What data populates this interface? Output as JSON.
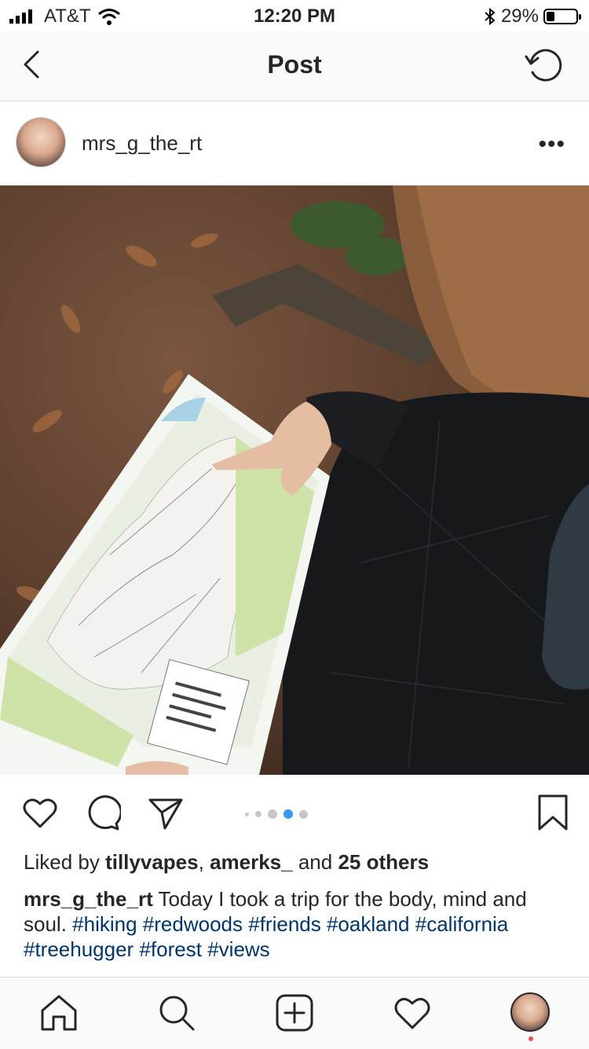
{
  "status": {
    "carrier": "AT&T",
    "time": "12:20 PM",
    "battery": "29%",
    "battery_level": 0.29
  },
  "nav": {
    "title": "Post"
  },
  "post": {
    "username": "mrs_g_the_rt",
    "carousel": {
      "count": 5,
      "active_index": 3
    },
    "likes": {
      "prefix": "Liked by",
      "user1": "tillyvapes",
      "sep": ",",
      "user2": "amerks_",
      "and": "and",
      "others": "25 others"
    },
    "caption": {
      "user": "mrs_g_the_rt",
      "text": "Today I took a trip for the body, mind and soul.",
      "tags": [
        "#hiking",
        "#redwoods",
        "#friends",
        "#oakland",
        "#california",
        "#treehugger",
        "#forest",
        "#views"
      ]
    }
  },
  "colors": {
    "hashtag": "#003569",
    "carousel_active": "#3897f0",
    "notification": "#ed4956"
  },
  "icons": [
    "signal-icon",
    "wifi-icon",
    "bluetooth-icon",
    "battery-icon",
    "back-icon",
    "refresh-icon",
    "more-icon",
    "heart-icon",
    "comment-icon",
    "share-icon",
    "bookmark-icon",
    "home-icon",
    "search-icon",
    "add-icon",
    "activity-icon",
    "profile-icon"
  ]
}
